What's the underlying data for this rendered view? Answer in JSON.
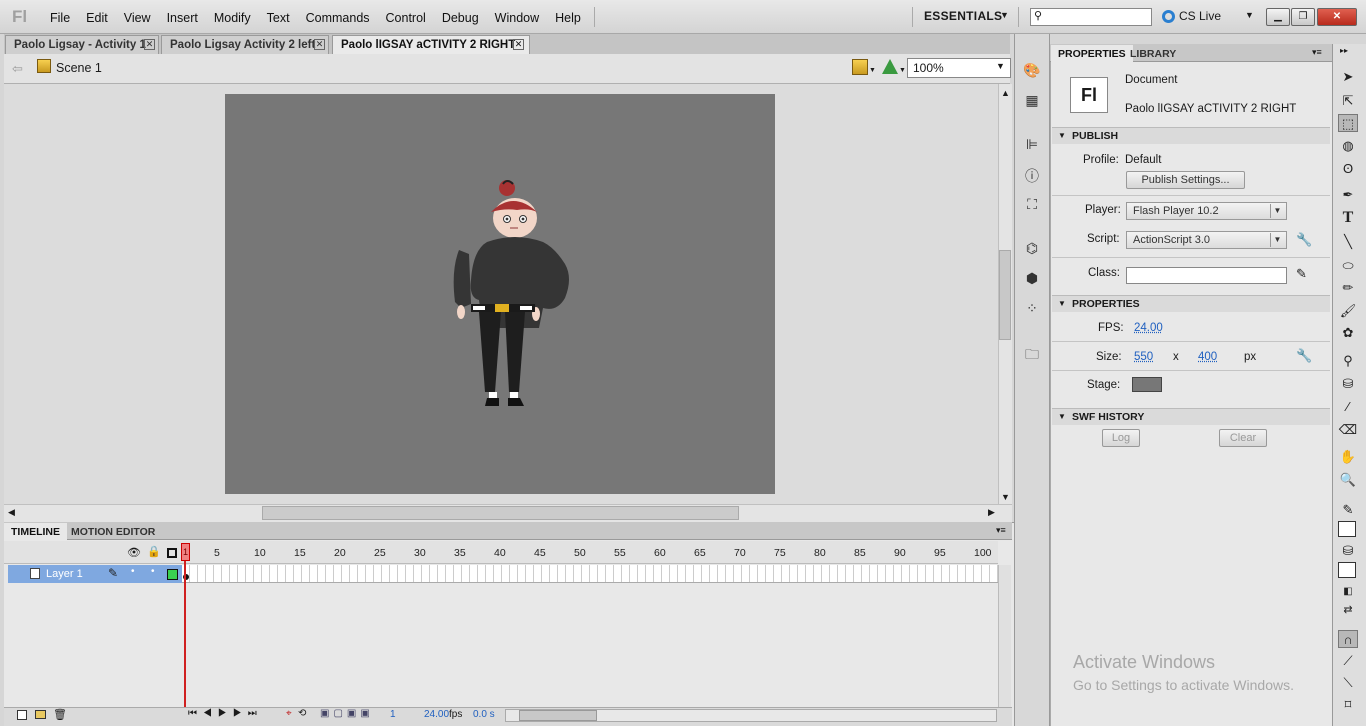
{
  "app": {
    "logo": "Fl",
    "menus": [
      "File",
      "Edit",
      "View",
      "Insert",
      "Modify",
      "Text",
      "Commands",
      "Control",
      "Debug",
      "Window",
      "Help"
    ],
    "workspace": "ESSENTIALS",
    "cslive": "CS Live",
    "search_placeholder": ""
  },
  "doc_tabs": [
    "Paolo Ligsay - Activity 1",
    "Paolo Ligsay Activity 2 left",
    "Paolo lIGSAY aCTIVITY 2 RIGHT"
  ],
  "editbar": {
    "scene": "Scene 1",
    "zoom": "100%"
  },
  "timeline": {
    "tabs": [
      "TIMELINE",
      "MOTION EDITOR"
    ],
    "frame_numbers": [
      "1",
      "5",
      "10",
      "15",
      "20",
      "25",
      "30",
      "35",
      "40",
      "45",
      "50",
      "55",
      "60",
      "65",
      "70",
      "75",
      "80",
      "85",
      "90",
      "95",
      "100"
    ],
    "layer": "Layer 1",
    "current_frame": "1",
    "fps": "24.00",
    "fps_unit": "fps",
    "time": "0.0 s"
  },
  "properties": {
    "tabs": [
      "PROPERTIES",
      "LIBRARY"
    ],
    "doc_type": "Document",
    "doc_name": "Paolo lIGSAY aCTIVITY 2 RIGHT",
    "icon": "Fl",
    "publish": {
      "header": "PUBLISH",
      "profile_label": "Profile:",
      "profile_value": "Default",
      "settings_btn": "Publish Settings...",
      "player_label": "Player:",
      "player_value": "Flash Player 10.2",
      "script_label": "Script:",
      "script_value": "ActionScript 3.0",
      "class_label": "Class:"
    },
    "props": {
      "header": "PROPERTIES",
      "fps_label": "FPS:",
      "fps_value": "24.00",
      "size_label": "Size:",
      "width": "550",
      "x": "x",
      "height": "400",
      "unit": "px",
      "stage_label": "Stage:"
    },
    "swf": {
      "header": "SWF HISTORY",
      "log_btn": "Log",
      "clear_btn": "Clear"
    }
  },
  "watermark": {
    "line1": "Activate Windows",
    "line2": "Go to Settings to activate Windows."
  },
  "colors": {
    "stage": "#777777",
    "layer_highlight": "#7fa8e0",
    "playhead": "#d02020"
  }
}
